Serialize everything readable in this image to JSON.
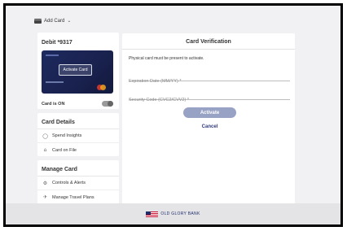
{
  "topbar": {
    "add_card_label": "Add Card"
  },
  "debit": {
    "title": "Debit *9317",
    "card_overlay_label": "Activate Card",
    "card_status_label": "Card is ON"
  },
  "card_details": {
    "title": "Card Details",
    "items": [
      {
        "label": "Spend Insights",
        "icon": "lightbulb-icon"
      },
      {
        "label": "Card on File",
        "icon": "cart-icon"
      }
    ]
  },
  "manage_card": {
    "title": "Manage Card",
    "items": [
      {
        "label": "Controls & Alerts",
        "icon": "gear-icon"
      },
      {
        "label": "Manage Travel Plans",
        "icon": "plane-icon"
      }
    ]
  },
  "verification": {
    "title": "Card Verification",
    "note": "Physical card must be present to activate.",
    "expiration_placeholder": "Expiration Date (MM/YY) *",
    "security_placeholder": "Security Code (CVC2/CVV2) *",
    "activate_label": "Activate",
    "cancel_label": "Cancel"
  },
  "footer": {
    "brand": "OLD GLORY BANK"
  },
  "colors": {
    "brand_navy": "#1f2d6b",
    "button_disabled": "#98a2c4",
    "card_blue": "#1d2a5e",
    "flag_red": "#c8102e"
  }
}
